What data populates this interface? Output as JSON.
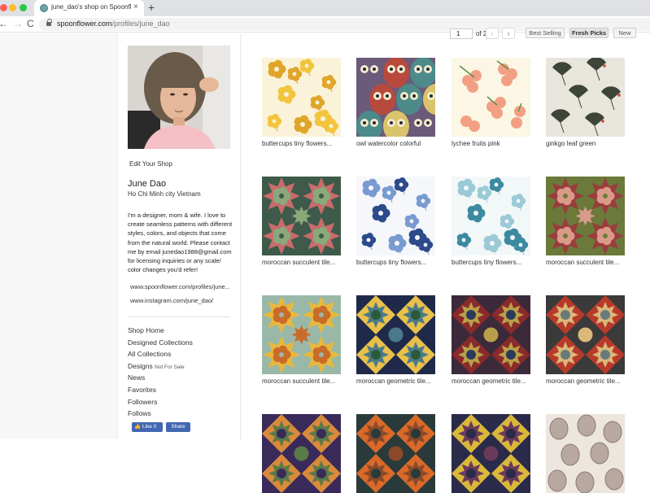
{
  "browser": {
    "tab_title": "june_dao's shop on Spoonflow",
    "tab_close": "×",
    "new_tab": "+",
    "back": "←",
    "forward": "→",
    "reload": "C",
    "url_domain": "spoonflower.com",
    "url_path": "/profiles/june_dao"
  },
  "sidebar": {
    "edit_shop": "Edit Your Shop",
    "name": "June Dao",
    "location": "Ho Chi Minh city Vietnam",
    "bio": "I'm a designer, mom & wife. I love to create seamless patterns with different styles, colors, and objects that come from the natural world. Please contact me by email junedao1988@gmail.com for licensing inquiries or any scale/ color changes you'd refer!",
    "link_spoonflower": "www.spoonflower.com/profiles/june...",
    "link_instagram": "www.instagram.com/june_dao/",
    "nav": {
      "shop_home": "Shop Home",
      "designed_collections": "Designed Collections",
      "all_collections": "All Collections",
      "designs": "Designs",
      "not_for_sale": "Not For Sale",
      "news": "News",
      "favorites": "Favorites",
      "followers": "Followers",
      "follows": "Follows"
    },
    "fb_like": "Like 0",
    "fb_share": "Share"
  },
  "pager": {
    "page": "1",
    "total": "of 2",
    "prev": "‹",
    "next": "›"
  },
  "sort": {
    "best_selling": "Best Selling",
    "fresh_picks": "Fresh Picks",
    "new": "New"
  },
  "designs": [
    {
      "title": "buttercups tiny flowers...",
      "pattern": "buttercup-yellow",
      "colors": [
        "#faf3d9",
        "#f2c53d",
        "#e0a52a"
      ]
    },
    {
      "title": "owl watercolor colorful",
      "pattern": "owl",
      "colors": [
        "#6b5a7a",
        "#b84a3d",
        "#4d8a8a",
        "#d9c36b"
      ]
    },
    {
      "title": "lychee fruits pink",
      "pattern": "lychee",
      "colors": [
        "#fbf7e4",
        "#f2a083",
        "#5f8a4a"
      ]
    },
    {
      "title": "ginkgo leaf green",
      "pattern": "ginkgo",
      "colors": [
        "#e8e6dc",
        "#3d4438",
        "#c94a3d"
      ]
    },
    {
      "title": "moroccan succulent tile...",
      "pattern": "moroccan-pink",
      "colors": [
        "#3e5a4a",
        "#c96b6b",
        "#8aa87a"
      ]
    },
    {
      "title": "buttercups tiny flowers...",
      "pattern": "buttercup-blue",
      "colors": [
        "#f5f7fb",
        "#2d4a8a",
        "#7a9bd1"
      ]
    },
    {
      "title": "buttercups tiny flowers...",
      "pattern": "buttercup-teal",
      "colors": [
        "#f2f7f8",
        "#3d8aa0",
        "#9bcad6"
      ]
    },
    {
      "title": "moroccan succulent tile...",
      "pattern": "moroccan-green",
      "colors": [
        "#6b7a3a",
        "#9a3d3d",
        "#d99a8a"
      ]
    },
    {
      "title": "moroccan succulent tile...",
      "pattern": "moroccan-yellow",
      "colors": [
        "#9ab8a8",
        "#e8b83d",
        "#c96b2a"
      ]
    },
    {
      "title": "moroccan geometric tile...",
      "pattern": "geo-navy",
      "colors": [
        "#1f2a4a",
        "#e8c04a",
        "#4a7a8a",
        "#2a5a3a"
      ]
    },
    {
      "title": "moroccan geometric tile...",
      "pattern": "geo-red",
      "colors": [
        "#3a2a3a",
        "#8a2a2a",
        "#b8a04a",
        "#2a3a5a"
      ]
    },
    {
      "title": "moroccan geometric tile...",
      "pattern": "geo-dark",
      "colors": [
        "#3a3a3a",
        "#b83a2a",
        "#d9b87a",
        "#6a7a7a"
      ]
    },
    {
      "title": "",
      "pattern": "geo-purple",
      "colors": [
        "#3a2a5a",
        "#d98a3a",
        "#5a7a4a"
      ]
    },
    {
      "title": "",
      "pattern": "geo-orange",
      "colors": [
        "#2a3a3a",
        "#d96a2a",
        "#8a4a2a"
      ]
    },
    {
      "title": "",
      "pattern": "geo-plum",
      "colors": [
        "#2a2a4a",
        "#d9b83a",
        "#6a3a5a"
      ]
    },
    {
      "title": "",
      "pattern": "eggs",
      "colors": [
        "#ece6df",
        "#b8a8a0",
        "#8a7a7a"
      ]
    }
  ]
}
